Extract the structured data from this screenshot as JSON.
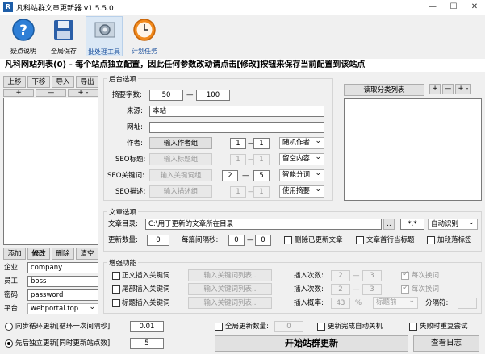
{
  "window": {
    "title": "凡科站群文章更新器 v1.5.5.0",
    "app_icon_letter": "R",
    "minimize": "—",
    "maximize": "☐",
    "close": "✕"
  },
  "toolbar": [
    {
      "label": "疑点说明",
      "icon": "help-icon"
    },
    {
      "label": "全局保存",
      "icon": "save-icon"
    },
    {
      "label": "批处理工具",
      "icon": "gear-icon"
    },
    {
      "label": "计划任务",
      "icon": "clock-icon"
    }
  ],
  "headline": "凡科网站列表(0) - 每个站点独立配置，因此任何参数改动请点击[修改]按钮来保存当前配置到该站点",
  "site_list": {
    "top_buttons": [
      "上移",
      "下移",
      "导入",
      "导出"
    ],
    "plus": "+",
    "minus": "—",
    "plusminus": "+ -",
    "bottom_buttons": [
      "添加",
      "修改",
      "删除",
      "清空"
    ],
    "fields": [
      {
        "label": "企业:",
        "value": "company"
      },
      {
        "label": "员工:",
        "value": "boss"
      },
      {
        "label": "密码:",
        "value": "password"
      },
      {
        "label": "平台:",
        "value": "webportal.top"
      }
    ]
  },
  "backend": {
    "title": "后台选项",
    "summary_label": "摘要字数:",
    "summary_min": "50",
    "summary_max": "100",
    "dash": "—",
    "source_label": "来源:",
    "source_value": "本站",
    "url_label": "网址:",
    "url_value": "",
    "author_label": "作者:",
    "author_btn": "输入作者组",
    "author_from": "1",
    "author_to": "1",
    "author_mode": "随机作者",
    "seo_title_label": "SEO标题:",
    "seo_title_btn": "输入标题组",
    "seo_title_from": "1",
    "seo_title_to": "1",
    "seo_title_mode": "留空内容",
    "seo_kw_label": "SEO关键词:",
    "seo_kw_btn": "输入关键词组",
    "seo_kw_from": "2",
    "seo_kw_to": "5",
    "seo_kw_mode": "智能分词",
    "seo_desc_label": "SEO描述:",
    "seo_desc_btn": "输入描述组",
    "seo_desc_from": "1",
    "seo_desc_to": "1",
    "seo_desc_mode": "使用摘要"
  },
  "category": {
    "read_btn": "读取分类列表",
    "plus": "+",
    "minus": "—",
    "plusminus": "+ -"
  },
  "article": {
    "title": "文章选项",
    "dir_label": "文章目录:",
    "dir_value": "C:\\用于更新的文章所在目录",
    "browse": "..",
    "ext_value": "*.*",
    "encoding": "自动识别",
    "count_label": "更新数量:",
    "count_value": "0",
    "interval_label": "每篇间隔秒:",
    "interval_from": "0",
    "interval_to": "0",
    "dash": "—",
    "delete_updated": "删除已更新文章",
    "first_line_title": "文章首行当标题",
    "add_paragraph_tag": "加段落标签"
  },
  "enhance": {
    "title": "增强功能",
    "rows": [
      {
        "label": "正文插入关键词",
        "btn": "输入关键词列表..",
        "count_label": "插入次数:",
        "from": "2",
        "to": "3",
        "extra": "每次换词"
      },
      {
        "label": "尾部插入关键词",
        "btn": "输入关键词列表..",
        "count_label": "插入次数:",
        "from": "2",
        "to": "3",
        "extra": "每次换词"
      },
      {
        "label": "标题插入关键词",
        "btn": "输入关键词列表..",
        "count_label": "插入概率:",
        "prob": "43",
        "percent": "%",
        "position": "标题前",
        "sep_label": "分隔符:",
        "sep_value": ":"
      }
    ]
  },
  "bottom": {
    "sync_loop_label": "同步循环更新[循环一次间隔秒]:",
    "sync_loop_value": "0.01",
    "seq_label": "先后独立更新[同时更新站点数]:",
    "seq_value": "5",
    "global_count_label": "全局更新数量:",
    "global_count_value": "0",
    "auto_shutdown": "更新完成自动关机",
    "retry_on_fail": "失败时重复尝试",
    "start_btn": "开始站群更新",
    "log_btn": "查看日志"
  }
}
